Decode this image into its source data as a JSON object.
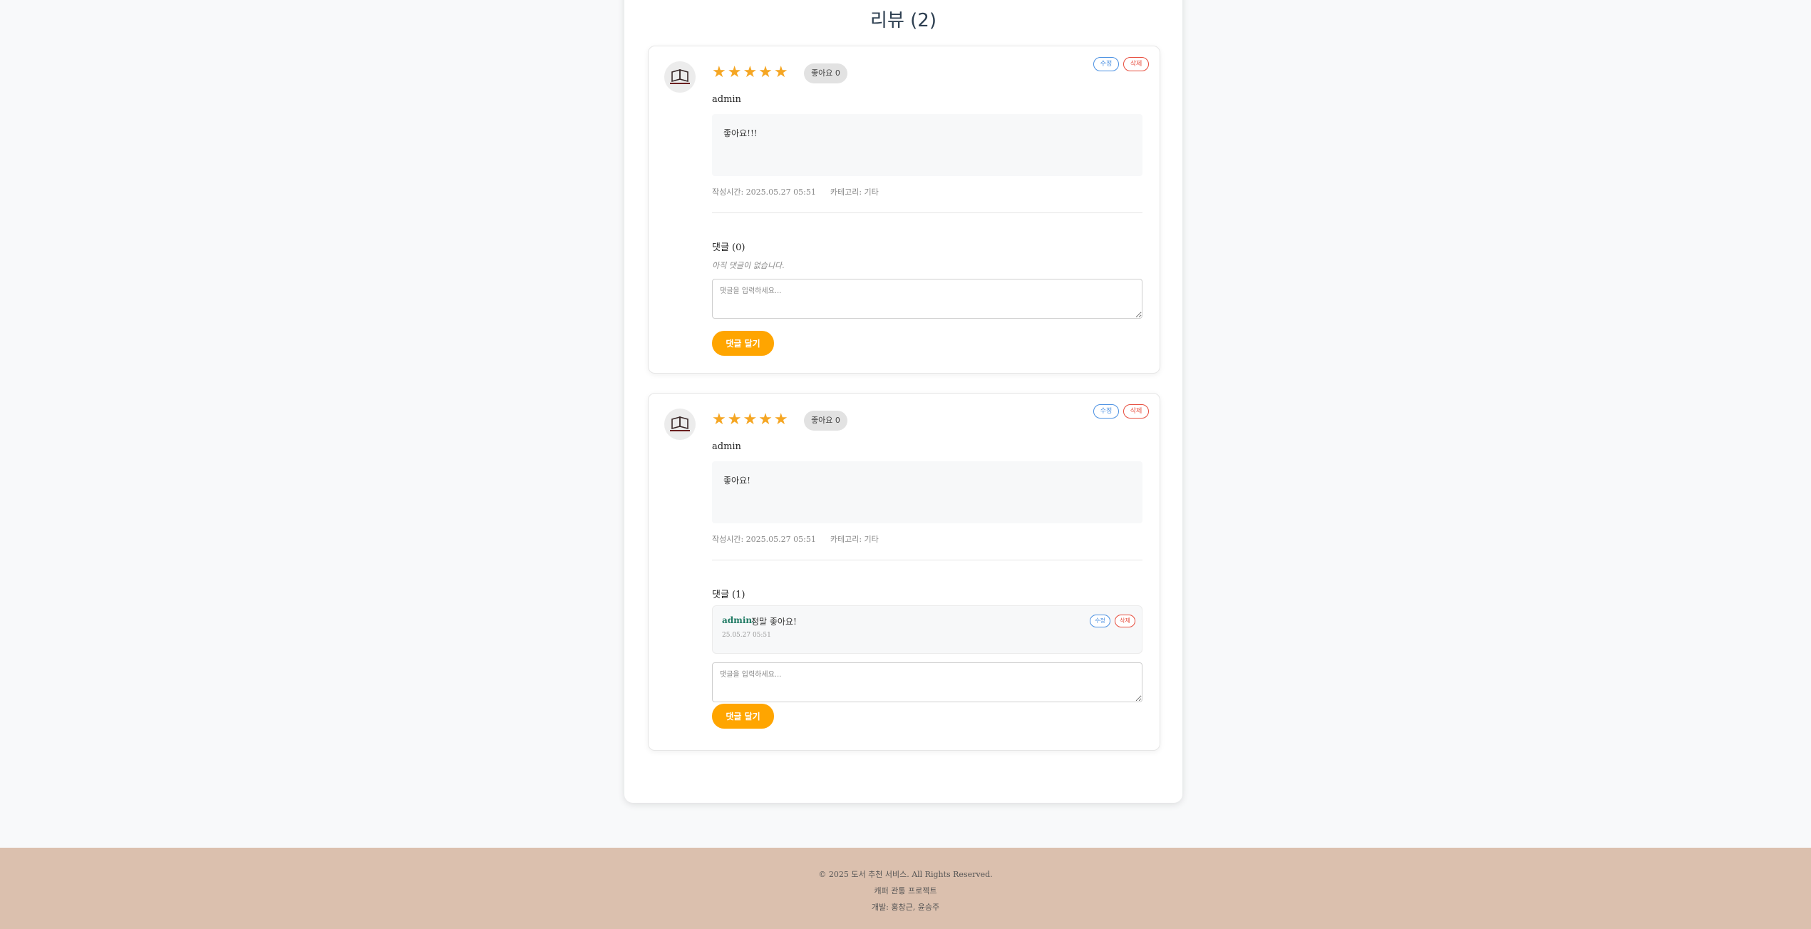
{
  "reviews_title": "리뷰 (2)",
  "reviews": [
    {
      "rating_stars": "★★★★★",
      "like_label": "좋아요 0",
      "edit_label": "수정",
      "delete_label": "삭제",
      "author": "admin",
      "content": "좋아요!!!",
      "created_at": "작성시간: 2025.05.27 05:51",
      "category": "카테고리: 기타",
      "comments_title": "댓글 (0)",
      "no_comments": "아직 댓글이 없습니다.",
      "comment_placeholder": "댓글을 입력하세요...",
      "submit_label": "댓글 달기",
      "comments": []
    },
    {
      "rating_stars": "★★★★★",
      "like_label": "좋아요 0",
      "edit_label": "수정",
      "delete_label": "삭제",
      "author": "admin",
      "content": "좋아요!",
      "created_at": "작성시간: 2025.05.27 05:51",
      "category": "카테고리: 기타",
      "comments_title": "댓글 (1)",
      "comment_placeholder": "댓글을 입력하세요...",
      "submit_label": "댓글 달기",
      "comments": [
        {
          "author": "admin:",
          "text": "정말 좋아요!",
          "time": "25.05.27 05:51",
          "edit_label": "수정",
          "delete_label": "삭제"
        }
      ]
    }
  ],
  "footer": {
    "copyright": "© 2025 도서 추천 서비스. All Rights Reserved.",
    "project": "캐퍼 관통 프로젝트",
    "developers": "개발: 홍창근, 윤승주"
  },
  "colors": {
    "accent": "#ffa500",
    "star": "#f5a623",
    "edit": "#4a90e2",
    "delete": "#e74c3c",
    "footer_bg": "#dbc0ae"
  },
  "icons": {
    "avatar": "open-book-icon"
  }
}
